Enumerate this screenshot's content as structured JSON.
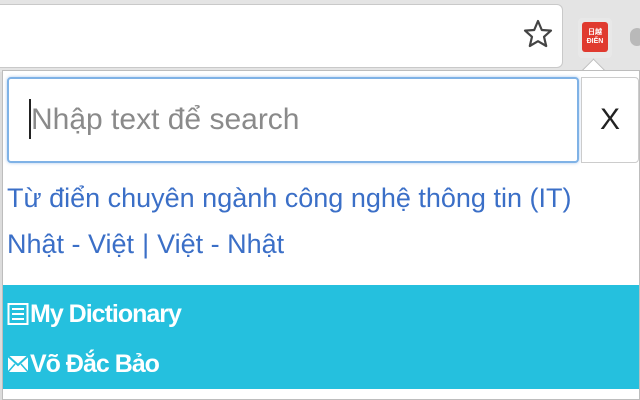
{
  "browser": {
    "bookmark_icon": "star-icon",
    "extension": {
      "icon": "dictionary-extension-icon",
      "badge_text": "日越 ĐIỂN",
      "color": "#e03a2f"
    }
  },
  "popup": {
    "search": {
      "placeholder": "Nhập text để search",
      "value": ""
    },
    "clear_label": "X",
    "title_link": "Từ điển chuyên ngành công nghệ thông tin (IT)",
    "languages": {
      "jp_vi": "Nhật - Việt",
      "separator": "|",
      "vi_jp": "Việt - Nhật"
    },
    "menu": {
      "background": "#25c0de",
      "items": [
        {
          "icon": "list-icon",
          "label": "My Dictionary"
        },
        {
          "icon": "mail-icon",
          "label": "Võ Đắc Bảo"
        }
      ]
    }
  }
}
